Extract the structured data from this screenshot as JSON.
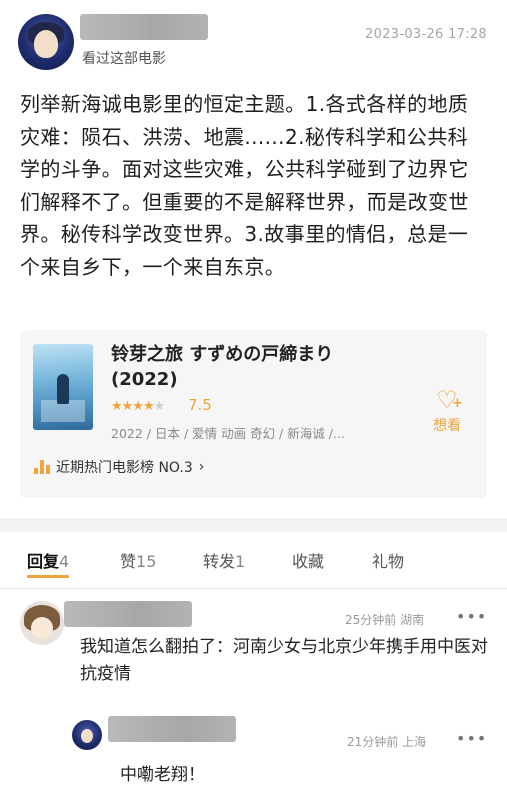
{
  "post": {
    "subtitle": "看过这部电影",
    "date": "2023-03-26 17:28",
    "text": "列举新海诚电影里的恒定主题。1.各式各样的地质灾难：陨石、洪涝、地震......2.秘传科学和公共科学的斗争。面对这些灾难，公共科学碰到了边界它们解释不了。但重要的不是解释世界，而是改变世界。秘传科学改变世界。3.故事里的情侣，总是一个来自乡下，一个来自东京。"
  },
  "movie": {
    "title": "铃芽之旅 すずめの戸締まり (2022)",
    "stars_filled": "★★★★",
    "stars_empty": "★",
    "rating": "7.5",
    "meta": "2022 / 日本 / 爱情 动画 奇幻 / 新海诚 /...",
    "want_label": "想看",
    "rank": "近期热门电影榜 NO.3",
    "rank_arrow": "›"
  },
  "tabs": [
    {
      "label": "回复",
      "count": "4"
    },
    {
      "label": "赞",
      "count": "15"
    },
    {
      "label": "转发",
      "count": "1"
    },
    {
      "label": "收藏",
      "count": ""
    },
    {
      "label": "礼物",
      "count": ""
    }
  ],
  "comments": [
    {
      "time": "25分钟前 湖南",
      "text": "我知道怎么翻拍了：河南少女与北京少年携手用中医对抗疫情"
    },
    {
      "time": "21分钟前 上海",
      "text": "中嘞老翔！"
    }
  ],
  "icons": {
    "more": "•••",
    "heart": "♡",
    "plus": "+"
  },
  "colors": {
    "accent": "#f0a33b"
  }
}
